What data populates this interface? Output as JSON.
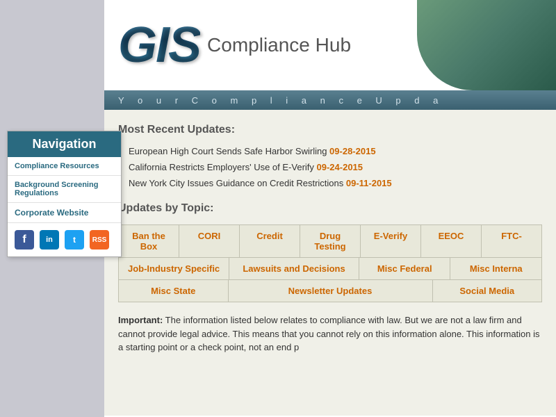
{
  "header": {
    "logo_gis": "GIS",
    "logo_text": "Compliance Hub",
    "tagline": "Y o u r   C o m p l i a n c e   U p d a"
  },
  "navigation": {
    "title": "Navigation",
    "items": [
      {
        "id": "compliance-resources",
        "label": "Compliance Resources"
      },
      {
        "id": "background-screening",
        "label": "Background Screening Regulations"
      },
      {
        "id": "corporate-website",
        "label": "Corporate Website"
      }
    ],
    "social": [
      {
        "id": "facebook",
        "label": "f",
        "type": "facebook"
      },
      {
        "id": "linkedin",
        "label": "in",
        "type": "linkedin"
      },
      {
        "id": "twitter",
        "label": "t",
        "type": "twitter"
      },
      {
        "id": "rss",
        "label": "rss",
        "type": "rss"
      }
    ]
  },
  "content": {
    "most_recent_title": "Most Recent Updates:",
    "updates": [
      {
        "text": "European High Court Sends Safe Harbor Swirling",
        "date": "09-28-2015"
      },
      {
        "text": "California Restricts Employers' Use of E-Verify",
        "date": "09-24-2015"
      },
      {
        "text": "New York City Issues Guidance on Credit Restrictions",
        "date": "09-11-2015"
      }
    ],
    "updates_by_topic_title": "Updates by Topic:",
    "topics_row1": [
      {
        "id": "ban-the-box",
        "label": "Ban the Box"
      },
      {
        "id": "cori",
        "label": "CORI"
      },
      {
        "id": "credit",
        "label": "Credit"
      },
      {
        "id": "drug-testing",
        "label": "Drug Testing"
      },
      {
        "id": "e-verify",
        "label": "E-Verify"
      },
      {
        "id": "eeoc",
        "label": "EEOC"
      },
      {
        "id": "ftc",
        "label": "FTC-"
      }
    ],
    "topics_row2": [
      {
        "id": "job-industry",
        "label": "Job-Industry Specific"
      },
      {
        "id": "lawsuits",
        "label": "Lawsuits and Decisions"
      },
      {
        "id": "misc-federal",
        "label": "Misc Federal"
      },
      {
        "id": "misc-interna",
        "label": "Misc Interna"
      }
    ],
    "topics_row3": [
      {
        "id": "misc-state",
        "label": "Misc State"
      },
      {
        "id": "newsletter",
        "label": "Newsletter Updates"
      },
      {
        "id": "social-media",
        "label": "Social Media"
      }
    ],
    "important_label": "Important:",
    "important_text": " The information listed below relates to compliance with law. But we are not a law firm and cannot provide legal advice. This means that you cannot rely on this information alone. This information is a starting point or a check point, not an end p"
  }
}
